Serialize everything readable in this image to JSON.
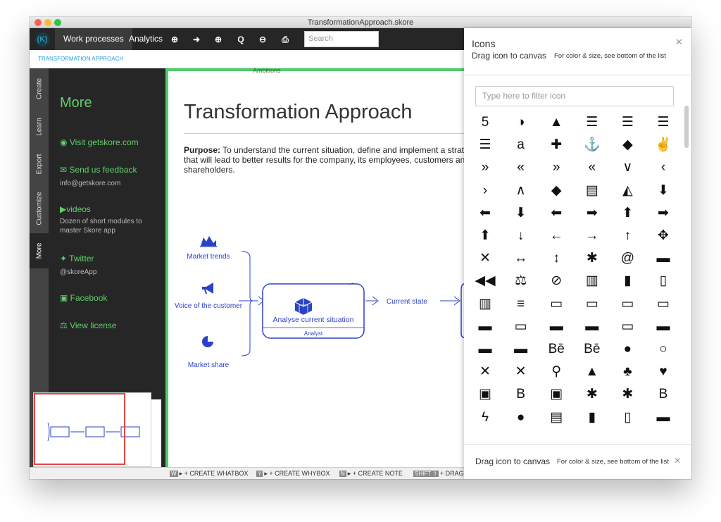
{
  "window": {
    "title": "TransformationApproach.skore"
  },
  "toolbar": {
    "logo": "(K)",
    "tabs": [
      {
        "label": "Work processes"
      },
      {
        "label": "Analytics"
      }
    ],
    "icons": [
      "zoom-fit-icon",
      "play-icon",
      "zoom-in-icon",
      "zoom-icon",
      "zoom-out-icon",
      "print-icon"
    ],
    "search_placeholder": "Search"
  },
  "breadcrumb": "TRANSFORMATION APPROACH",
  "side_tabs": [
    {
      "label": "Create"
    },
    {
      "label": "Learn"
    },
    {
      "label": "Export"
    },
    {
      "label": "Customize"
    },
    {
      "label": "More"
    }
  ],
  "more_panel": {
    "title": "More",
    "website": "Visit getskore.com",
    "feedback": "Send us feedback",
    "feedback_email": "info@getskore.com",
    "videos": "videos",
    "videos_desc": "Dozen of short modules to master Skore app",
    "twitter": "Twitter",
    "twitter_handle": "@skoreApp",
    "facebook": "Facebook",
    "license": "View license"
  },
  "canvas": {
    "top_label": "Ambitions",
    "title": "Transformation Approach",
    "purpose_label": "Purpose:",
    "purpose_text": " To understand the current situation, define and implement a strategy that will lead to better results for the company, its employees, customers and shareholders.",
    "inputs": [
      "Market trends",
      "Voice of the customer",
      "Market share"
    ],
    "whatbox": {
      "label": "Analyse current situation",
      "role": "Analyst"
    },
    "output": "Current state"
  },
  "bottom_bar": {
    "items": [
      {
        "key": "W",
        "label": "+ CREATE WHATBOX"
      },
      {
        "key": "Y",
        "label": "+ CREATE WHYBOX"
      },
      {
        "key": "N",
        "label": "+ CREATE NOTE"
      },
      {
        "key": "SHIFT ⇧",
        "label": "+ DRAG"
      }
    ]
  },
  "icons_panel": {
    "title": "Icons",
    "subtitle": "Drag icon to canvas",
    "hint": "For color & size, see bottom of the list",
    "filter_placeholder": "Type here to filter icon",
    "footer_title": "Drag icon to canvas",
    "footer_hint": "For color & size, see bottom of the list",
    "icons": [
      "500px-icon",
      "adjust-icon",
      "adn-icon",
      "align-center-icon",
      "align-justify-icon",
      "align-left-icon",
      "align-right-icon",
      "amazon-icon",
      "ambulance-icon",
      "anchor-icon",
      "android-icon",
      "angellist-icon",
      "angle-double-down-icon",
      "angle-double-left-icon",
      "angle-double-right-icon",
      "angle-double-up-icon",
      "angle-down-icon",
      "angle-left-icon",
      "angle-right-icon",
      "angle-up-icon",
      "apple-icon",
      "archive-icon",
      "area-chart-icon",
      "arrow-circle-down-icon",
      "arrow-circle-left-icon",
      "arrow-circle-o-down-icon",
      "arrow-circle-o-left-icon",
      "arrow-circle-o-right-icon",
      "arrow-circle-o-up-icon",
      "arrow-circle-right-icon",
      "arrow-circle-up-icon",
      "arrow-down-icon",
      "arrow-left-icon",
      "arrow-right-icon",
      "arrow-up-icon",
      "arrows-icon",
      "arrows-alt-icon",
      "arrows-h-icon",
      "arrows-v-icon",
      "asterisk-icon",
      "at-icon",
      "automobile-icon",
      "backward-icon",
      "balance-scale-icon",
      "ban-icon",
      "bank-icon",
      "bar-chart-icon",
      "bar-chart-o-icon",
      "barcode-icon",
      "bars-icon",
      "battery-empty-icon",
      "battery-quarter-icon",
      "battery-half-icon",
      "battery-three-quarters-icon",
      "battery-full-icon",
      "battery-0-icon",
      "battery-3-icon",
      "battery-2-icon",
      "battery-1-icon",
      "battery-4-icon",
      "bed-icon",
      "beer-icon",
      "behance-icon",
      "behance-square-icon",
      "bell-icon",
      "bell-o-icon",
      "bell-slash-icon",
      "bell-slash-o-icon",
      "bicycle-icon",
      "binoculars-icon",
      "birthday-cake-icon",
      "bitbucket-icon",
      "bitbucket-square-icon",
      "bitcoin-icon",
      "black-tie-icon",
      "bluetooth-icon",
      "bluetooth-b-icon",
      "bold-icon",
      "bolt-icon",
      "bomb-icon",
      "book-icon",
      "bookmark-icon",
      "bookmark-o-icon",
      "briefcase-icon"
    ],
    "glyphs": [
      "5",
      "◑",
      "▲",
      "☰",
      "☰",
      "☰",
      "☰",
      "a",
      "✚",
      "⚓",
      "◆",
      "✌",
      "»",
      "«",
      "»",
      "«",
      "∨",
      "‹",
      "›",
      "∧",
      "◆",
      "▤",
      "◭",
      "⬇",
      "⬅",
      "⬇",
      "⬅",
      "➡",
      "⬆",
      "➡",
      "⬆",
      "↓",
      "←",
      "→",
      "↑",
      "✥",
      "✕",
      "↔",
      "↕",
      "✱",
      "@",
      "▬",
      "◀◀",
      "⚖",
      "⊘",
      "▥",
      "▮",
      "▯",
      "▥",
      "≡",
      "▭",
      "▭",
      "▭",
      "▭",
      "▬",
      "▭",
      "▬",
      "▬",
      "▭",
      "▬",
      "▬",
      "▬",
      "Bē",
      "Bē",
      "●",
      "○",
      "✕",
      "✕",
      "⚲",
      "▲",
      "♣",
      "♥",
      "▣",
      "B",
      "▣",
      "✱",
      "✱",
      "B",
      "ϟ",
      "●",
      "▤",
      "▮",
      "▯",
      "▬"
    ]
  }
}
